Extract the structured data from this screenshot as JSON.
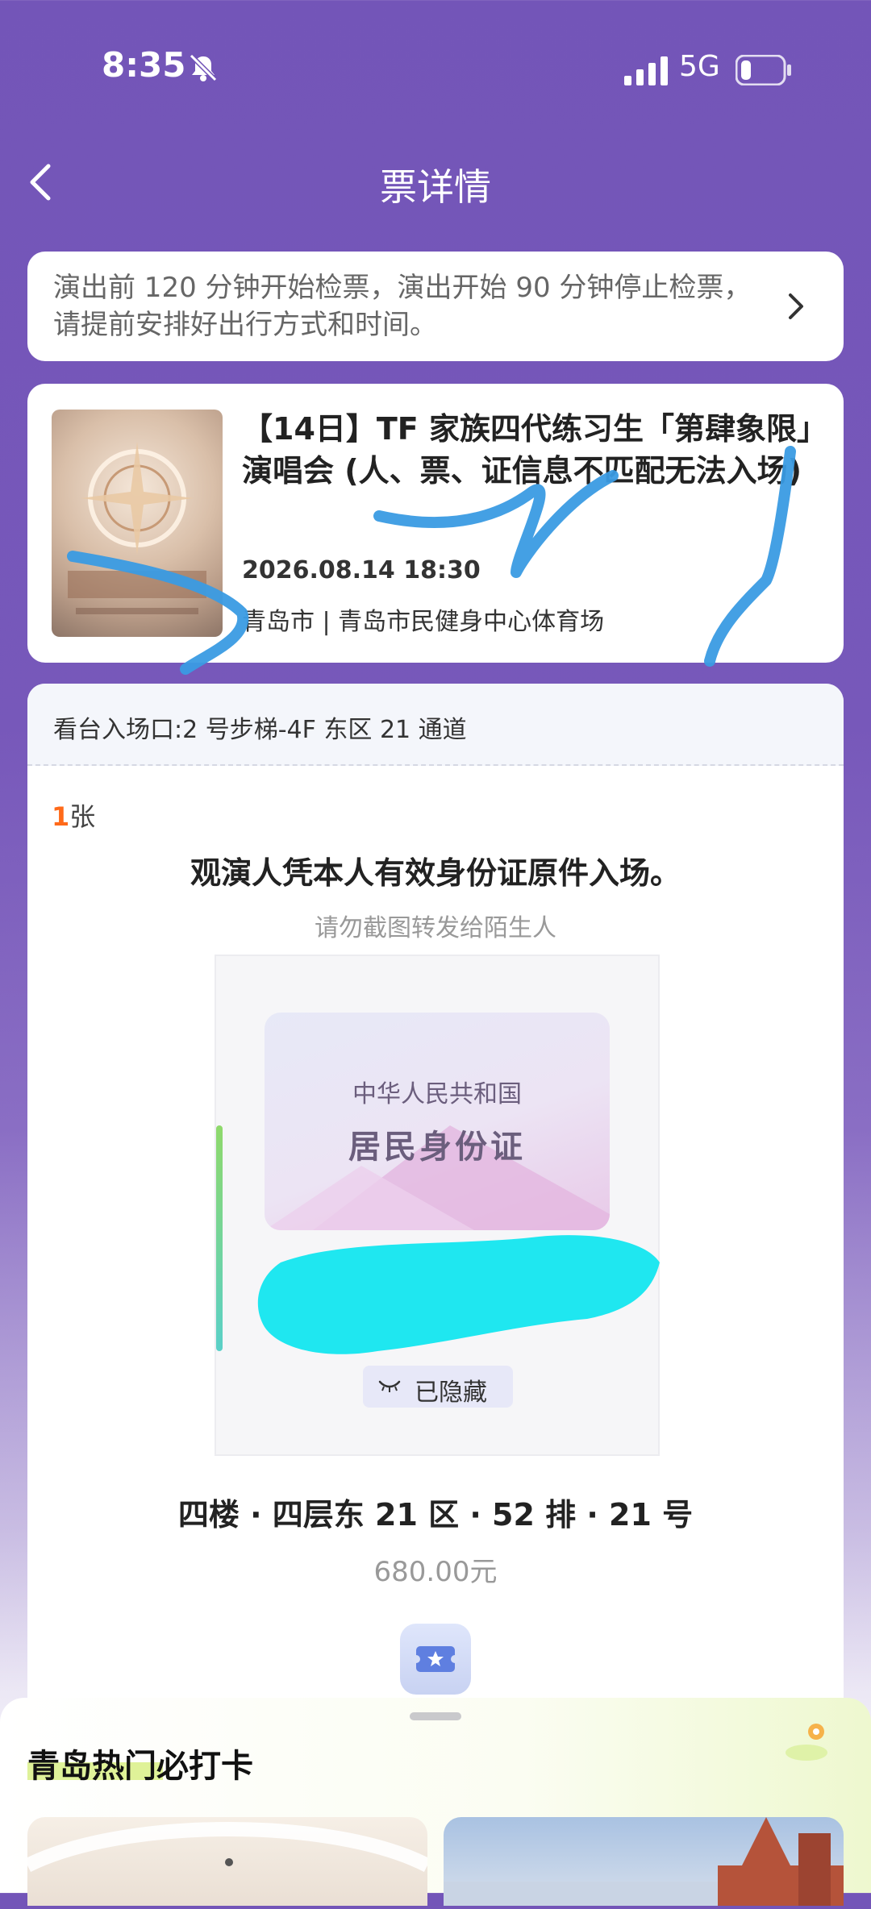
{
  "status_bar": {
    "time": "8:35",
    "network": "5G"
  },
  "nav": {
    "title": "票详情"
  },
  "notice": {
    "text": "演出前 120 分钟开始检票，演出开始 90 分钟停止检票，请提前安排好出行方式和时间。"
  },
  "event": {
    "title": "【14日】TF 家族四代练习生「第肆象限」演唱会 (人、票、证信息不匹配无法入场)",
    "datetime": "2026.08.14 18:30",
    "venue": "青岛市 | 青岛市民健身中心体育场"
  },
  "ticket": {
    "gate": "看台入场口:2 号步梯-4F 东区 21 通道",
    "count_num": "1",
    "count_unit": "张",
    "id_requirement": "观演人凭本人有效身份证原件入场。",
    "warning": "请勿截图转发给陌生人",
    "id_card_country": "中华人民共和国",
    "id_card_doc": "居民身份证",
    "hidden_label": "已隐藏",
    "seat": "四楼 · 四层东 21 区 · 52 排 · 21 号",
    "price": "680.00元"
  },
  "bottom_sheet": {
    "title": "青岛热门必打卡"
  },
  "colors": {
    "header_purple": "#7355b8",
    "accent_orange": "#ff6a1a",
    "scribble_blue": "#3a9be3",
    "scribble_cyan": "#1fe7f0"
  }
}
